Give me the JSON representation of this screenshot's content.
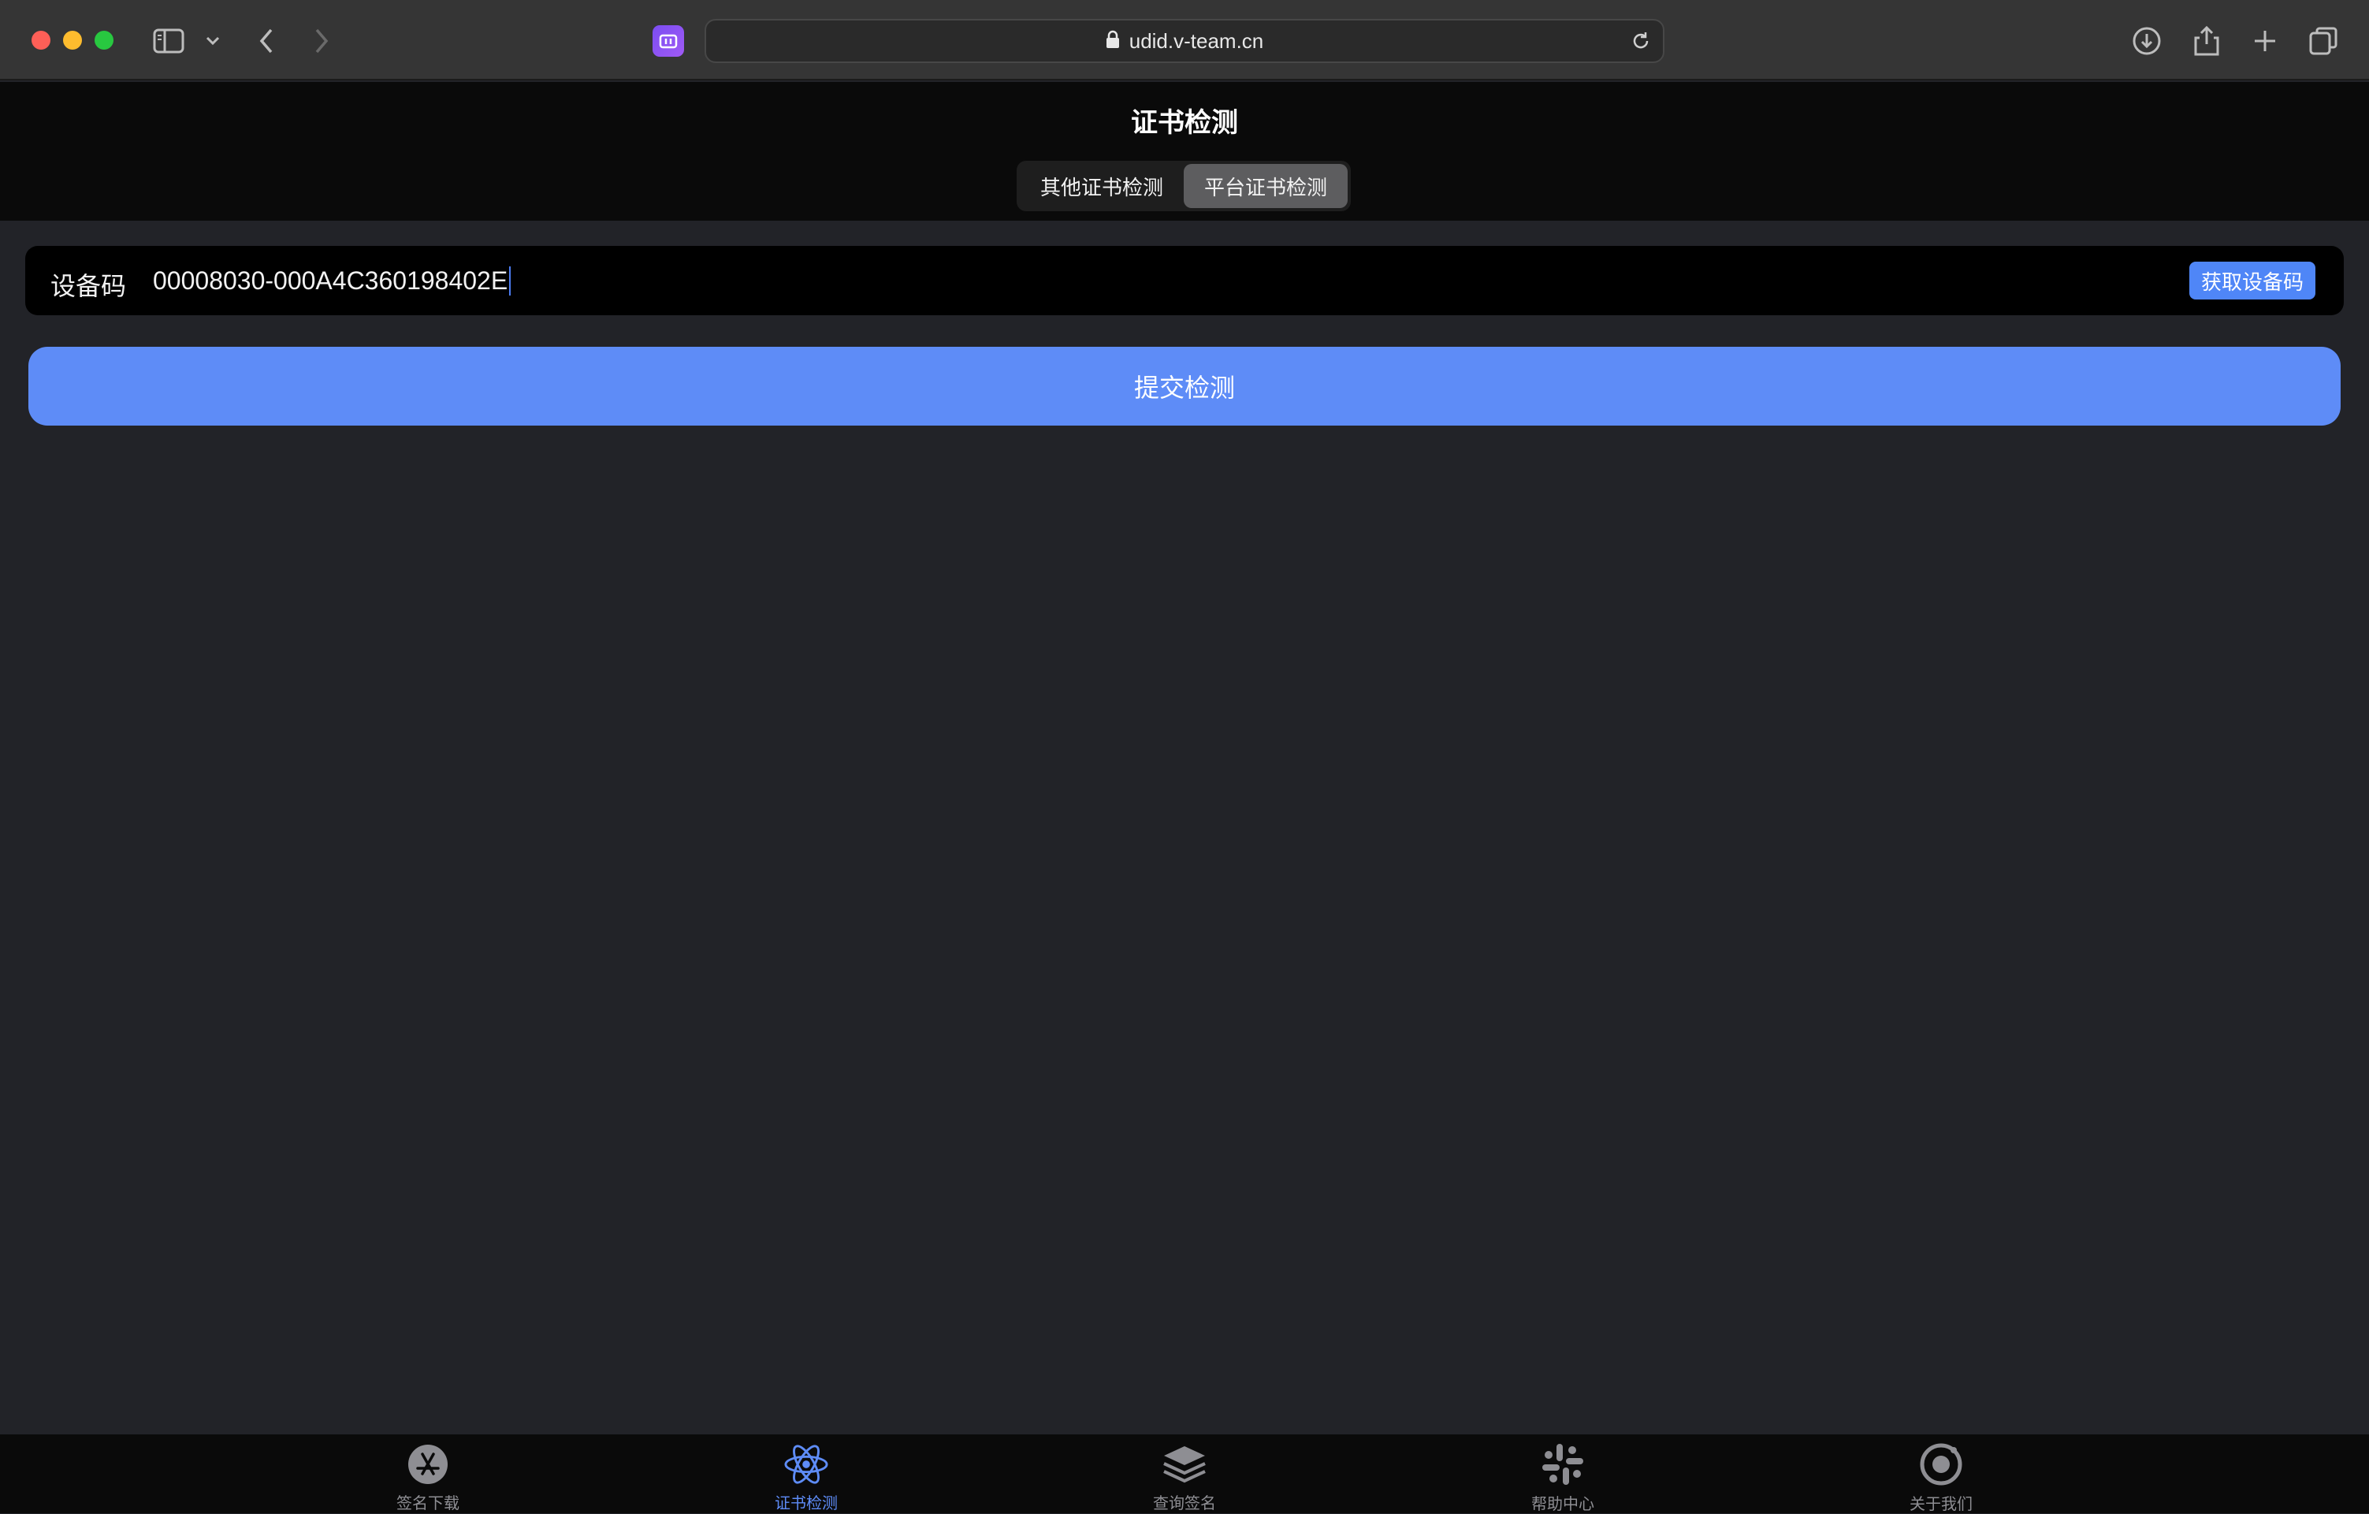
{
  "browser": {
    "url": "udid.v-team.cn"
  },
  "header": {
    "title": "证书检测",
    "segments": [
      {
        "label": "其他证书检测",
        "active": false
      },
      {
        "label": "平台证书检测",
        "active": true
      }
    ]
  },
  "device": {
    "label": "设备码",
    "value": "00008030-000A4C360198402E",
    "get_button": "获取设备码"
  },
  "submit_label": "提交检测",
  "tabs": [
    {
      "label": "签名下载",
      "icon": "app-store-icon",
      "active": false
    },
    {
      "label": "证书检测",
      "icon": "atom-icon",
      "active": true
    },
    {
      "label": "查询签名",
      "icon": "layers-icon",
      "active": false
    },
    {
      "label": "帮助中心",
      "icon": "hash-grid-icon",
      "active": false
    },
    {
      "label": "关于我们",
      "icon": "target-icon",
      "active": false
    }
  ],
  "colors": {
    "accent": "#5e8cf7",
    "header_bg": "#0a0a0a",
    "content_bg": "#222328"
  }
}
